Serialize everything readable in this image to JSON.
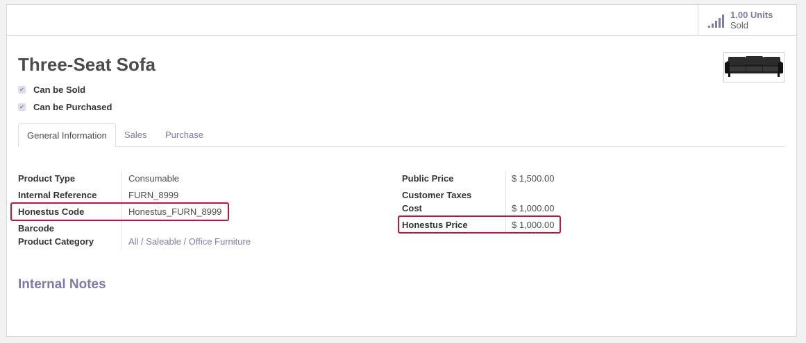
{
  "stat_button": {
    "value": "1.00 Units",
    "label": "Sold"
  },
  "product": {
    "name": "Three-Seat Sofa",
    "checkboxes": [
      {
        "label": "Can be Sold",
        "checked": true
      },
      {
        "label": "Can be Purchased",
        "checked": true
      }
    ]
  },
  "tabs": [
    {
      "label": "General Information",
      "active": true
    },
    {
      "label": "Sales",
      "active": false
    },
    {
      "label": "Purchase",
      "active": false
    }
  ],
  "left_fields": [
    {
      "label": "Product Type",
      "value": "Consumable"
    },
    {
      "label": "Internal Reference",
      "value": "FURN_8999"
    },
    {
      "label": "Honestus Code",
      "value": "Honestus_FURN_8999",
      "highlighted": true
    },
    {
      "label": "Barcode",
      "value": ""
    },
    {
      "label": "Product Category",
      "value": "All / Saleable / Office Furniture"
    }
  ],
  "right_fields": [
    {
      "label": "Public Price",
      "value": "$ 1,500.00"
    },
    {
      "label": "Customer Taxes",
      "value": ""
    },
    {
      "label": "Cost",
      "value": "$ 1,000.00"
    },
    {
      "label": "Honestus Price",
      "value": "$ 1,000.00",
      "highlighted": true
    }
  ],
  "internal_notes": {
    "title": "Internal Notes"
  },
  "colors": {
    "accent": "#7c7bad",
    "highlight_border": "#c8103c"
  },
  "icons": {
    "stat": "bar-chart-icon",
    "check": "checkmark-icon",
    "product_image": "sofa-image"
  }
}
